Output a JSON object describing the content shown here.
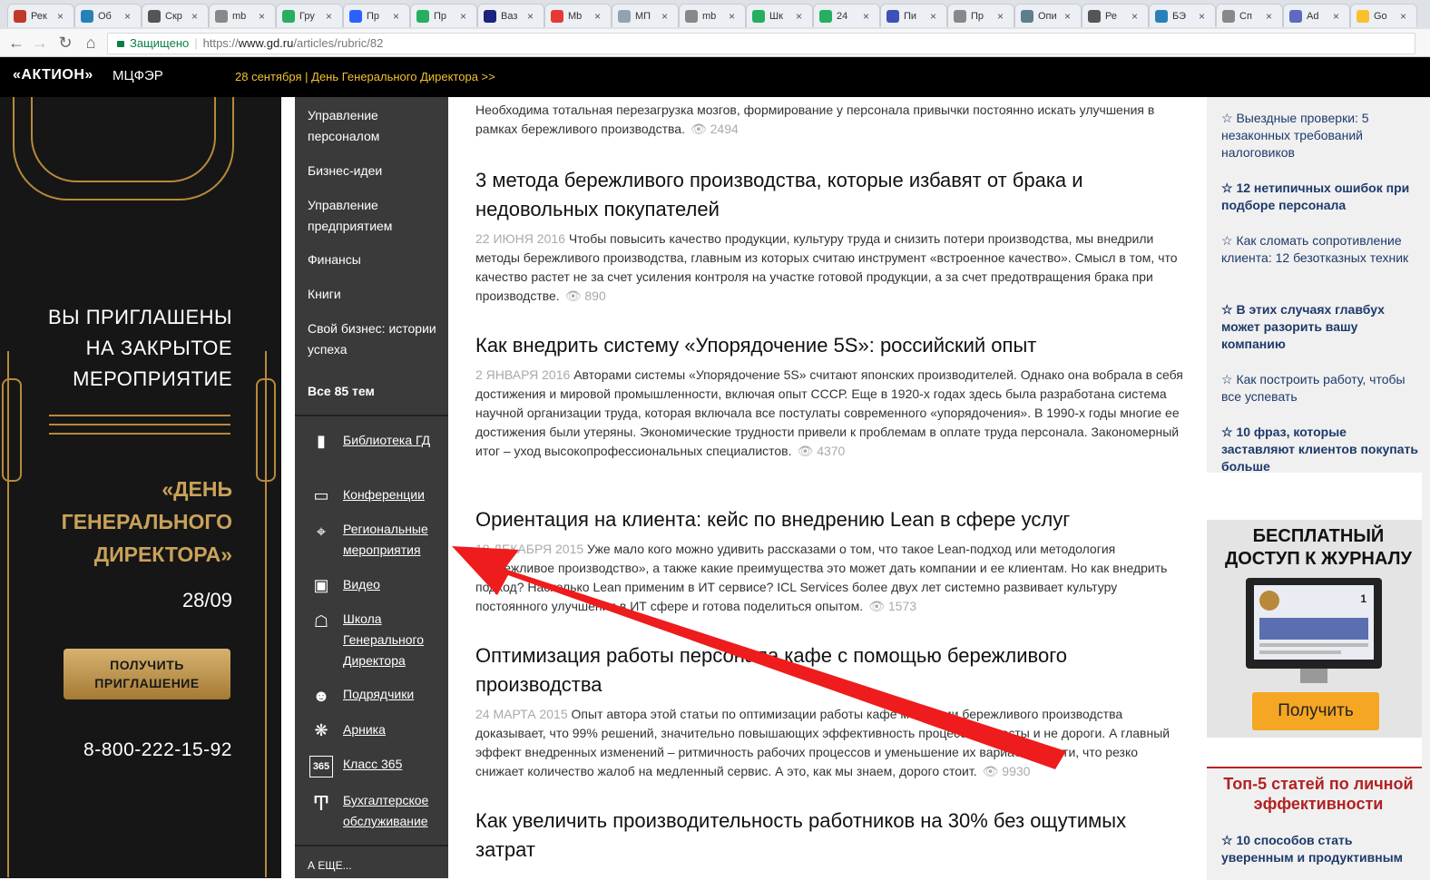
{
  "browser": {
    "tabs": [
      "Рек",
      "Об",
      "Скр",
      "mb",
      "Гру",
      "Пр",
      "Пр",
      "Ваз",
      "Mb",
      "МП",
      "mb",
      "Шк",
      "24",
      "Пи",
      "Пр",
      "Опи",
      "Ре",
      "БЭ",
      "Сп",
      "Ad",
      "Go"
    ],
    "secure_label": "Защищено",
    "url_prefix": "https://",
    "url_host": "www.gd.ru",
    "url_path": "/articles/rubric/82"
  },
  "site": {
    "logo": "«АКТИОН»",
    "logo2": "МЦФЭР",
    "top_announcement": "28 сентября | День Генерального Директора >>"
  },
  "banner": {
    "title_lines": [
      "ВЫ ПРИГЛАШЕНЫ",
      "НА ЗАКРЫТОЕ",
      "МЕРОПРИЯТИЕ"
    ],
    "event_lines": [
      "«ДЕНЬ",
      "ГЕНЕРАЛЬНОГО",
      "ДИРЕКТОРА»"
    ],
    "date": "28/09",
    "button": "ПОЛУЧИТЬ ПРИГЛАШЕНИЕ",
    "phone": "8-800-222-15-92"
  },
  "left_menu": {
    "topics": [
      {
        "label": "Управление персоналом"
      },
      {
        "label": "Бизнес-идеи"
      },
      {
        "label": "Управление предприятием"
      },
      {
        "label": "Финансы"
      },
      {
        "label": "Книги"
      },
      {
        "label": "Свой бизнес: истории успеха"
      }
    ],
    "all_topics": "Все 85 тем",
    "services": [
      {
        "label": "Библиотека ГД",
        "icon": "book-icon"
      },
      {
        "label": "Конференции",
        "icon": "screen-icon"
      },
      {
        "label": "Региональные мероприятия",
        "icon": "map-pin-icon"
      },
      {
        "label": "Видео",
        "icon": "video-icon"
      },
      {
        "label": "Школа Генерального Директора",
        "icon": "school-icon"
      },
      {
        "label": "Подрядчики",
        "icon": "people-icon"
      },
      {
        "label": "Арника",
        "icon": "flower-icon"
      },
      {
        "label": "Класс 365",
        "icon": "class365-icon"
      },
      {
        "label": "Бухгалтерское обслуживание",
        "icon": "accounting-icon"
      }
    ],
    "more": "А ЕЩЕ..."
  },
  "articles": [
    {
      "title": "",
      "date": "",
      "text": "Необходима тотальная перезагрузка мозгов, формирование у персонала привычки постоянно искать улучшения в рамках бережливого производства.",
      "views": "2494"
    },
    {
      "title": "3 метода бережливого производства, которые избавят от брака и недовольных покупателей",
      "date": "22 июня 2016",
      "text": "Чтобы повысить качество продукции, культуру труда и снизить потери производства, мы внедрили методы бережливого производства, главным из которых считаю инструмент «встроенное качество». Смысл в том, что качество растет не за счет усиления контроля на участке готовой продукции, а за счет предотвращения брака при производстве.",
      "views": "890"
    },
    {
      "title": "Как внедрить систему «Упорядочение 5S»: российский опыт",
      "date": "2 января 2016",
      "text": "Авторами системы «Упорядочение 5S» считают японских производителей. Однако она вобрала в себя достижения и мировой промышленности, включая опыт СССР. Еще в 1920-х годах здесь была разработана система научной организации труда, которая включала все постулаты современного «упорядочения». В 1990-х годы многие ее достижения были утеряны. Экономические трудности привели к проблемам в оплате труда персонала. Закономерный итог – уход высокопрофессиональных специалистов.",
      "views": "4370"
    },
    {
      "title": "Ориентация на клиента: кейс по внедрению Lean в сфере услуг",
      "date": "18 декабря 2015",
      "text": "Уже мало кого можно удивить рассказами о том, что такое Lean-подход или методология «бережливое производство», а также какие преимущества это может дать компании и ее клиентам. Но как внедрить подход? Насколько Lean применим в ИТ сервисе? ICL Services более двух лет системно развивает культуру постоянного улучшения в ИТ сфере и готова поделиться опытом.",
      "views": "1573"
    },
    {
      "title": "Оптимизация работы персонала кафе с помощью бережливого производства",
      "date": "24 марта 2015",
      "text": "Опыт автора этой статьи по оптимизации работы кафе методами бережливого производства доказывает, что 99% решений, значительно повышающих эффективность процессов, просты и не дороги. А главный эффект внедренных изменений – ритмичность рабочих процессов и уменьшение их вариабельности, что резко снижает количество жалоб на медленный сервис. А это, как мы знаем, дорого стоит.",
      "views": "9930"
    },
    {
      "title": "Как увеличить производительность работников на 30% без ощутимых затрат",
      "date": "",
      "text": "",
      "views": ""
    }
  ],
  "right_links": [
    {
      "label": "☆ Выездные проверки: 5 незаконных требований налоговиков",
      "bold": false
    },
    {
      "label": "☆ 12 нетипичных ошибок при подборе персонала",
      "bold": true
    },
    {
      "label": "☆ Как сломать сопротивление клиента: 12 безотказных техник",
      "bold": false
    },
    {
      "label": "☆ В этих случаях главбух может разорить вашу компанию",
      "bold": true
    },
    {
      "label": "☆ Как построить работу, чтобы все успевать",
      "bold": false
    },
    {
      "label": "☆ 10 фраз, которые заставляют клиентов покупать больше",
      "bold": true
    }
  ],
  "promo": {
    "title_lines": [
      "БЕСПЛАТНЫЙ",
      "ДОСТУП К ЖУРНАЛУ"
    ],
    "button": "Получить",
    "screen_number": "1"
  },
  "top5": {
    "title": "Топ-5 статей по личной эффективности",
    "first": "☆ 10 способов стать уверенным и продуктивным"
  },
  "colors": {
    "accent_gold": "#c9a25a",
    "top_yellow": "#f2c230",
    "link_blue": "#1d3a6b",
    "arrow_red": "#ee1c1c",
    "promo_orange": "#f5a623"
  }
}
